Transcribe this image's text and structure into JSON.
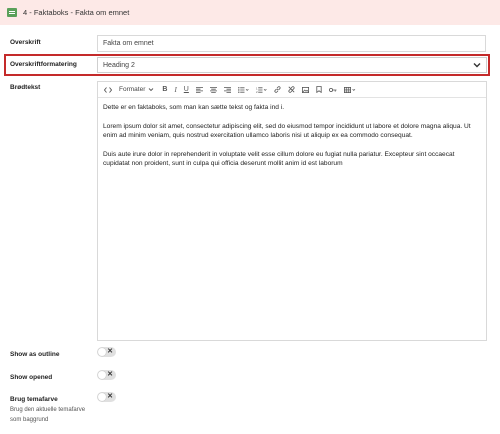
{
  "header": {
    "title": "4 - Faktaboks - Fakta om emnet",
    "icon": "block-icon",
    "background": "#fde9e7"
  },
  "form": {
    "overskrift_label": "Overskrift",
    "overskrift_value": "Fakta om emnet",
    "formatering_label": "Overskriftformatering",
    "formatering_value": "Heading 2",
    "brodtekst_label": "Brødtekst",
    "show_outline_label": "Show as outline",
    "show_opened_label": "Show opened",
    "temafarve_label": "Brug temafarve",
    "temafarve_help_1": "Brug den aktuelle temafarve",
    "temafarve_help_2": "som baggrund"
  },
  "editor": {
    "toolbar": {
      "formats_label": "Formater",
      "icons": [
        "code-icon",
        "formats-dropdown",
        "bold-icon",
        "italic-icon",
        "underline-icon",
        "align-left-icon",
        "align-center-icon",
        "align-right-icon",
        "bullet-list-icon",
        "numbered-list-icon",
        "link-icon",
        "unlink-icon",
        "image-icon",
        "bookmark-icon",
        "key-link-icon",
        "table-icon"
      ]
    },
    "paragraphs": [
      "Dette er en faktaboks, som man kan sætte tekst og fakta ind i.",
      "Lorem ipsum dolor sit amet, consectetur adipiscing elit, sed do eiusmod tempor incididunt ut labore et dolore magna aliqua. Ut enim ad minim veniam, quis nostrud exercitation ullamco laboris nisi ut aliquip ex ea commodo consequat.",
      "Duis aute irure dolor in reprehenderit in voluptate velit esse cillum dolore eu fugiat nulla pariatur. Excepteur sint occaecat cupidatat non proident, sunt in culpa qui officia deserunt mollit anim id est laborum"
    ]
  },
  "toggles": {
    "off_symbol": "✕"
  },
  "colors": {
    "highlight": "#c42a2a",
    "header_icon": "#5aa05a"
  }
}
